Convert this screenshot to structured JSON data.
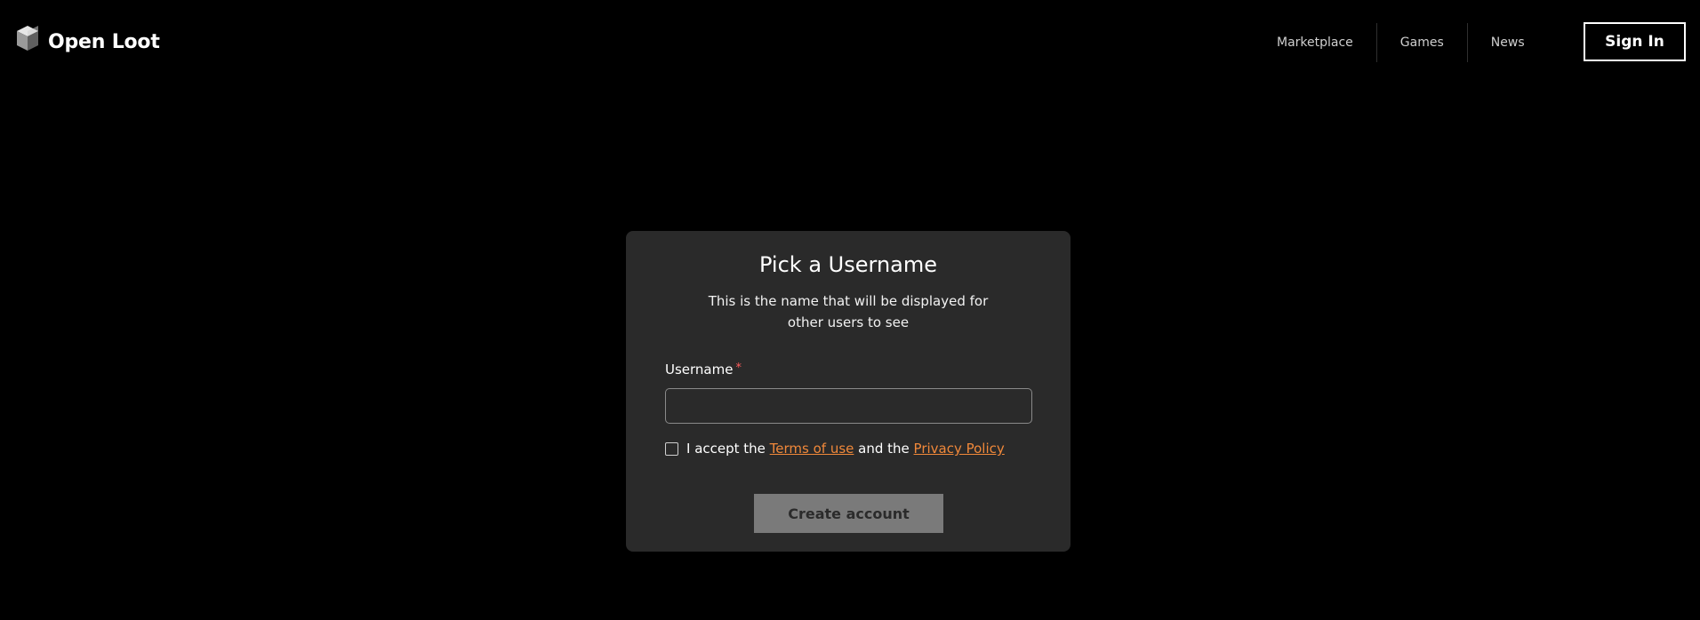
{
  "header": {
    "logo_text": "Open Loot",
    "logo_icon": "open-loot-cube-icon",
    "nav": [
      {
        "label": "Marketplace"
      },
      {
        "label": "Games"
      },
      {
        "label": "News"
      }
    ],
    "sign_in_label": "Sign In"
  },
  "card": {
    "title": "Pick a Username",
    "subtitle": "This is the name that will be displayed for other users to see",
    "username_label": "Username",
    "required_marker": "*",
    "username_value": "",
    "username_placeholder": "",
    "accept": {
      "checked": false,
      "prefix": "I accept the ",
      "terms_link": "Terms of use",
      "middle": " and the ",
      "privacy_link": "Privacy Policy"
    },
    "create_button_label": "Create account"
  },
  "colors": {
    "background": "#000000",
    "card": "#2a2a2a",
    "link": "#f0883a",
    "required": "#ff5c5c",
    "button_disabled": "#7a7a7a"
  }
}
